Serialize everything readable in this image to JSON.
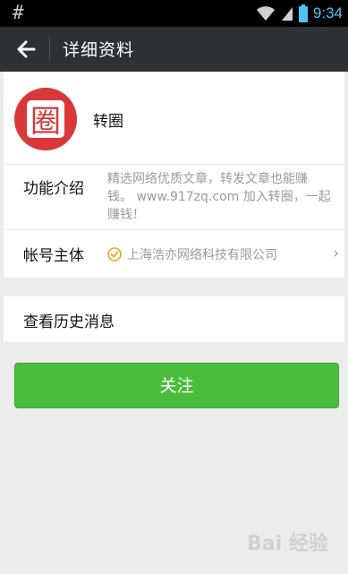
{
  "status_bar": {
    "left_symbol": "#",
    "time": "9:34",
    "icons": [
      "wifi-icon",
      "signal-icon",
      "battery-icon"
    ]
  },
  "title_bar": {
    "back_icon": "back-arrow-icon",
    "title": "详细资料"
  },
  "profile": {
    "logo_glyph": "圈",
    "name": "转圈"
  },
  "details": {
    "intro_label": "功能介绍",
    "intro_text": "精选网络优质文章，转发文章也能赚钱。 www.917zq.com 加入转圈，一起赚钱！",
    "owner_label": "帐号主体",
    "owner_text": "上海浩亦网络科技有限公司",
    "verified_icon": "verified-check-icon",
    "chevron": "›"
  },
  "history": {
    "label": "查看历史消息"
  },
  "follow_button": {
    "label": "关注"
  },
  "watermark": {
    "text": "Bai 经验"
  },
  "colors": {
    "title_bar_bg": "#2d3135",
    "follow_green": "#4bbd3c",
    "logo_red": "#d9383a",
    "page_bg": "#ececec"
  }
}
